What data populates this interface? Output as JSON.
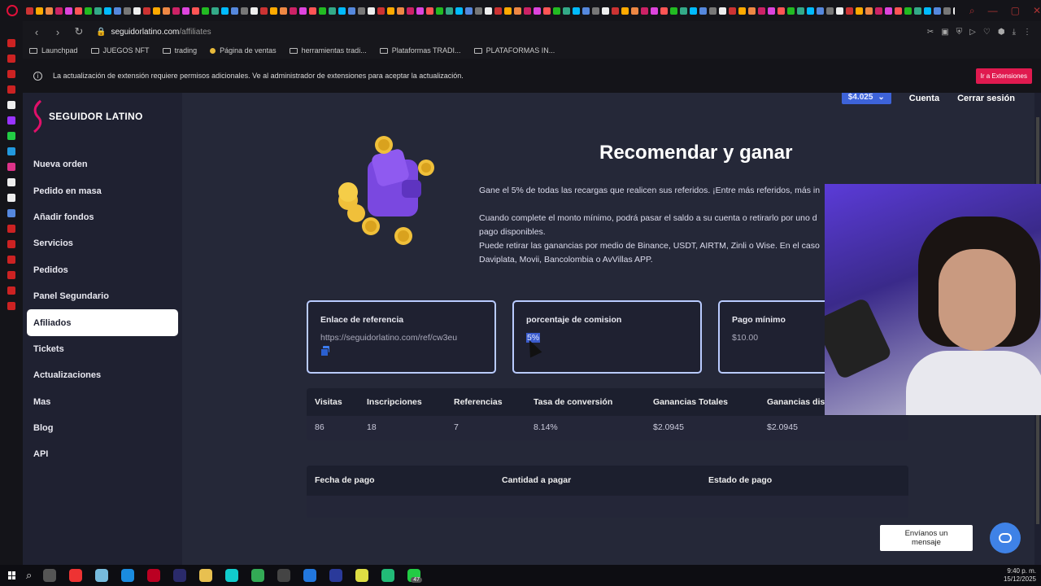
{
  "browser": {
    "url_host": "seguidorlatino.com",
    "url_path": "/affiliates",
    "bookmarks": [
      "Launchpad",
      "JUEGOS NFT",
      "trading",
      "Página de ventas",
      "herramientas tradi...",
      "Plataformas TRADI...",
      "PLATAFORMAS IN..."
    ],
    "infobar_text": "La actualización de extensión requiere permisos adicionales. Ve al administrador de extensiones para aceptar la actualización.",
    "infobar_button": "Ir a Extensiones"
  },
  "brand": {
    "name": "SEGUIDOR LATINO",
    "accent": "#e0106a"
  },
  "sidebar": {
    "items": [
      {
        "label": "Nueva orden"
      },
      {
        "label": "Pedido en masa"
      },
      {
        "label": "Añadir fondos"
      },
      {
        "label": "Servicios"
      },
      {
        "label": "Pedidos"
      },
      {
        "label": "Panel Segundario"
      },
      {
        "label": "Afiliados"
      },
      {
        "label": "Tickets"
      },
      {
        "label": "Actualizaciones"
      },
      {
        "label": "Mas"
      },
      {
        "label": "Blog"
      },
      {
        "label": "API"
      }
    ],
    "active": "Afiliados"
  },
  "topnav": {
    "balance": "$4.025",
    "account": "Cuenta",
    "logout": "Cerrar sesión"
  },
  "hero": {
    "title": "Recomendar y ganar",
    "line1": "Gane el 5% de todas las recargas que realicen sus referidos. ¡Entre más referidos, más in",
    "line2": "Cuando complete el monto mínimo, podrá pasar el saldo a su cuenta o retirarlo por uno d",
    "line3": "pago disponibles.",
    "line4": "Puede retirar las ganancias por medio de Binance, USDT,  AIRTM, Zinli o Wise. En el caso",
    "line5": "Daviplata, Movii, Bancolombia o AvVillas APP."
  },
  "cards": {
    "referral_label": "Enlace de referencia",
    "referral_value": "https://seguidorlatino.com/ref/cw3eu",
    "commission_label": "porcentaje de comision",
    "commission_value": "5%",
    "minimum_label": "Pago mínimo",
    "minimum_value": "$10.00"
  },
  "stats": {
    "headers": [
      "Visitas",
      "Inscripciones",
      "Referencias",
      "Tasa de conversión",
      "Ganancias Totales",
      "Ganancias disp"
    ],
    "values": [
      "86",
      "18",
      "7",
      "8.14%",
      "$2.0945",
      "$2.0945"
    ]
  },
  "payouts": {
    "headers": [
      "Fecha de pago",
      "Cantidad a pagar",
      "Estado de pago"
    ]
  },
  "chat": {
    "bubble_line1": "Envíanos un",
    "bubble_line2": "mensaje"
  },
  "taskbar": {
    "time": "9:40 p. m.",
    "date": "15/12/2025",
    "badge": "47"
  }
}
